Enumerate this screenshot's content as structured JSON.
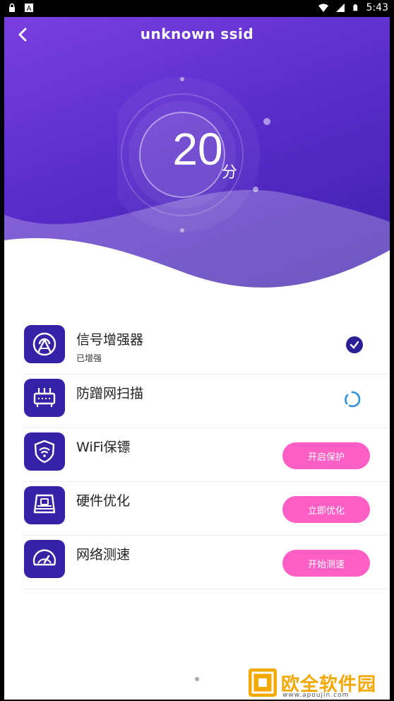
{
  "status_bar": {
    "time": "5:43",
    "icons": [
      "lock-icon",
      "a-icon",
      "wifi-icon",
      "signal-icon",
      "battery-icon"
    ]
  },
  "header": {
    "back_icon": "chevron-left-icon",
    "title": "unknown ssid"
  },
  "score": {
    "value": "20",
    "unit": "分"
  },
  "items": [
    {
      "title": "信号增强器",
      "subtitle": "已增强",
      "icon": "signal-antenna-icon",
      "action": "check"
    },
    {
      "title": "防蹭网扫描",
      "subtitle": "",
      "icon": "router-icon",
      "action": "loading"
    },
    {
      "title": "WiFi保镖",
      "subtitle": "",
      "icon": "shield-wifi-icon",
      "action": "button",
      "button_label": "开启保护"
    },
    {
      "title": "硬件优化",
      "subtitle": "",
      "icon": "hardware-icon",
      "action": "button",
      "button_label": "立即优化"
    },
    {
      "title": "网络测速",
      "subtitle": "",
      "icon": "speedometer-icon",
      "action": "button",
      "button_label": "开始测速"
    }
  ],
  "watermark": {
    "text": "欧全软件园",
    "url": "www.apoujin.com"
  },
  "colors": {
    "hero_start": "#7a3fe0",
    "hero_end": "#3a1fa8",
    "icon_bg": "#3522a6",
    "pill": "#ff5fc4"
  }
}
